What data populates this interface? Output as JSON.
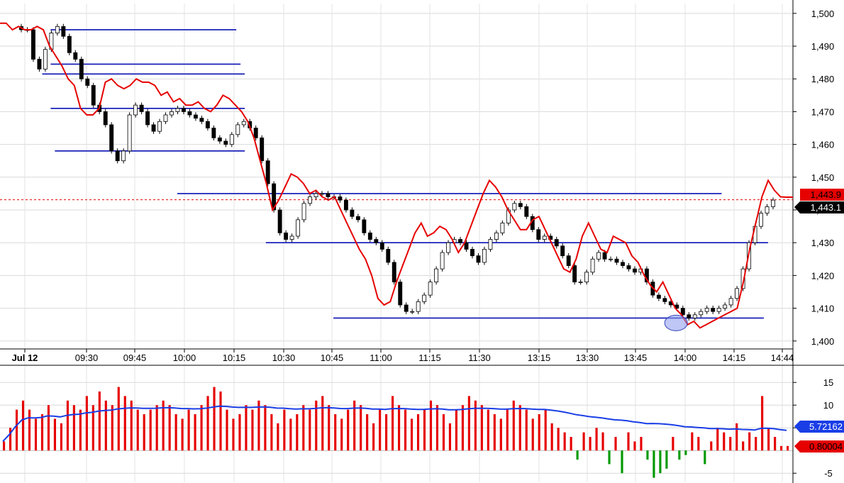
{
  "chart_data": {
    "type": "candlestick",
    "price_panel": {
      "y_ticks": [
        "1,500",
        "1,490",
        "1,480",
        "1,470",
        "1,460",
        "1,450",
        "1,440",
        "1,430",
        "1,420",
        "1,410",
        "1,400"
      ],
      "ylim": [
        1398,
        1503
      ],
      "grid": true,
      "last_price": "1,443.1",
      "overlay_last": "1,443.9",
      "dashed_level": 1443.1,
      "candles_close": [
        1495,
        1495,
        1486,
        1483,
        1489,
        1494,
        1496,
        1493,
        1488,
        1486,
        1480,
        1478,
        1472,
        1470,
        1466,
        1458,
        1455,
        1458,
        1469,
        1472,
        1470,
        1466,
        1464,
        1467,
        1469,
        1470,
        1471,
        1470,
        1469,
        1468,
        1467,
        1465,
        1462,
        1461,
        1460,
        1463,
        1466,
        1467,
        1465,
        1462,
        1455,
        1448,
        1440,
        1433,
        1431,
        1432,
        1437,
        1442,
        1444,
        1445,
        1445,
        1444,
        1444,
        1443,
        1440,
        1438,
        1437,
        1433,
        1431,
        1430,
        1428,
        1424,
        1418,
        1411,
        1409,
        1409,
        1412,
        1414,
        1418,
        1422,
        1427,
        1430,
        1431,
        1430,
        1428,
        1426,
        1424,
        1428,
        1431,
        1433,
        1436,
        1440,
        1442,
        1441,
        1438,
        1434,
        1431,
        1432,
        1431,
        1429,
        1426,
        1423,
        1418,
        1418,
        1421,
        1425,
        1427,
        1425,
        1425,
        1424,
        1423,
        1422,
        1421,
        1422,
        1418,
        1414,
        1413,
        1412,
        1411,
        1410,
        1408,
        1407,
        1408,
        1409,
        1410,
        1409,
        1410,
        1411,
        1413,
        1416,
        1422,
        1430,
        1435,
        1439,
        1441,
        1443
      ],
      "overlay_values": [
        1497,
        1497,
        1495,
        1496,
        1495,
        1495,
        1496,
        1495,
        1490,
        1487,
        1484,
        1480,
        1478,
        1471,
        1469,
        1469,
        1471,
        1479,
        1480,
        1478,
        1477,
        1478,
        1480,
        1479,
        1479,
        1478,
        1475,
        1476,
        1473,
        1474,
        1472,
        1472,
        1473,
        1471,
        1470,
        1472,
        1475,
        1474,
        1472,
        1470,
        1467,
        1462,
        1455,
        1448,
        1440,
        1443,
        1447,
        1451,
        1450,
        1448,
        1445,
        1446,
        1444,
        1443,
        1444,
        1440,
        1436,
        1432,
        1428,
        1425,
        1420,
        1413,
        1411,
        1412,
        1418,
        1423,
        1428,
        1433,
        1436,
        1432,
        1433,
        1435,
        1434,
        1431,
        1427,
        1430,
        1435,
        1440,
        1445,
        1449,
        1447,
        1444,
        1440,
        1437,
        1434,
        1434,
        1437,
        1438,
        1434,
        1430,
        1426,
        1422,
        1421,
        1425,
        1432,
        1436,
        1432,
        1428,
        1427,
        1432,
        1431,
        1430,
        1426,
        1424,
        1420,
        1417,
        1415,
        1418,
        1414,
        1410,
        1408,
        1405,
        1406,
        1404,
        1405,
        1406,
        1407,
        1408,
        1409,
        1410,
        1418,
        1428,
        1436,
        1444,
        1449,
        1446,
        1444,
        1443.9,
        1443.9
      ],
      "horizontal_levels": [
        {
          "y": 1495,
          "x0": 0.06,
          "x1": 0.28
        },
        {
          "y": 1484.5,
          "x0": 0.06,
          "x1": 0.285
        },
        {
          "y": 1481.5,
          "x0": 0.05,
          "x1": 0.29
        },
        {
          "y": 1471,
          "x0": 0.06,
          "x1": 0.29
        },
        {
          "y": 1458,
          "x0": 0.065,
          "x1": 0.29
        },
        {
          "y": 1445,
          "x0": 0.21,
          "x1": 0.855
        },
        {
          "y": 1430,
          "x0": 0.315,
          "x1": 0.91
        },
        {
          "y": 1407,
          "x0": 0.395,
          "x1": 0.905
        }
      ],
      "ellipse_annotation": {
        "x": 0.801,
        "y": 1405.5
      }
    },
    "x_ticks": [
      "Jul 12",
      "09:30",
      "09:45",
      "10:00",
      "10:15",
      "10:30",
      "10:45",
      "11:00",
      "11:15",
      "11:30",
      "13:15",
      "13:30",
      "13:45",
      "14:00",
      "14:15",
      "14:44"
    ],
    "volume_panel": {
      "y_ticks": [
        "15",
        "10",
        "5",
        "-5"
      ],
      "ylim": [
        -7,
        18
      ],
      "bars": [
        2,
        5,
        9,
        11,
        9,
        7,
        8,
        10,
        7,
        6,
        11,
        10,
        9,
        12,
        10,
        13,
        11,
        10,
        14,
        12,
        11,
        9,
        8,
        9,
        10,
        11,
        10,
        8,
        7,
        9,
        8,
        10,
        12,
        14,
        13,
        9,
        7,
        8,
        10,
        9,
        11,
        10,
        8,
        6,
        9,
        7,
        8,
        10,
        9,
        11,
        12,
        10,
        8,
        7,
        9,
        11,
        10,
        8,
        6,
        9,
        8,
        12,
        10,
        9,
        7,
        8,
        9,
        11,
        10,
        8,
        6,
        9,
        10,
        12,
        11,
        10,
        9,
        8,
        7,
        9,
        11,
        10,
        9,
        7,
        8,
        9,
        6,
        5,
        4,
        3,
        -2,
        4,
        3,
        5,
        4,
        -3,
        3,
        -5,
        4,
        2,
        3,
        -2,
        -6,
        -5,
        -4,
        3,
        -2,
        -1,
        4,
        3,
        -3,
        2,
        5,
        4,
        3,
        6,
        2,
        4,
        3,
        12,
        5,
        3,
        1,
        1
      ],
      "moving_average_end": "5.72162",
      "last_value": "0.80004"
    }
  }
}
